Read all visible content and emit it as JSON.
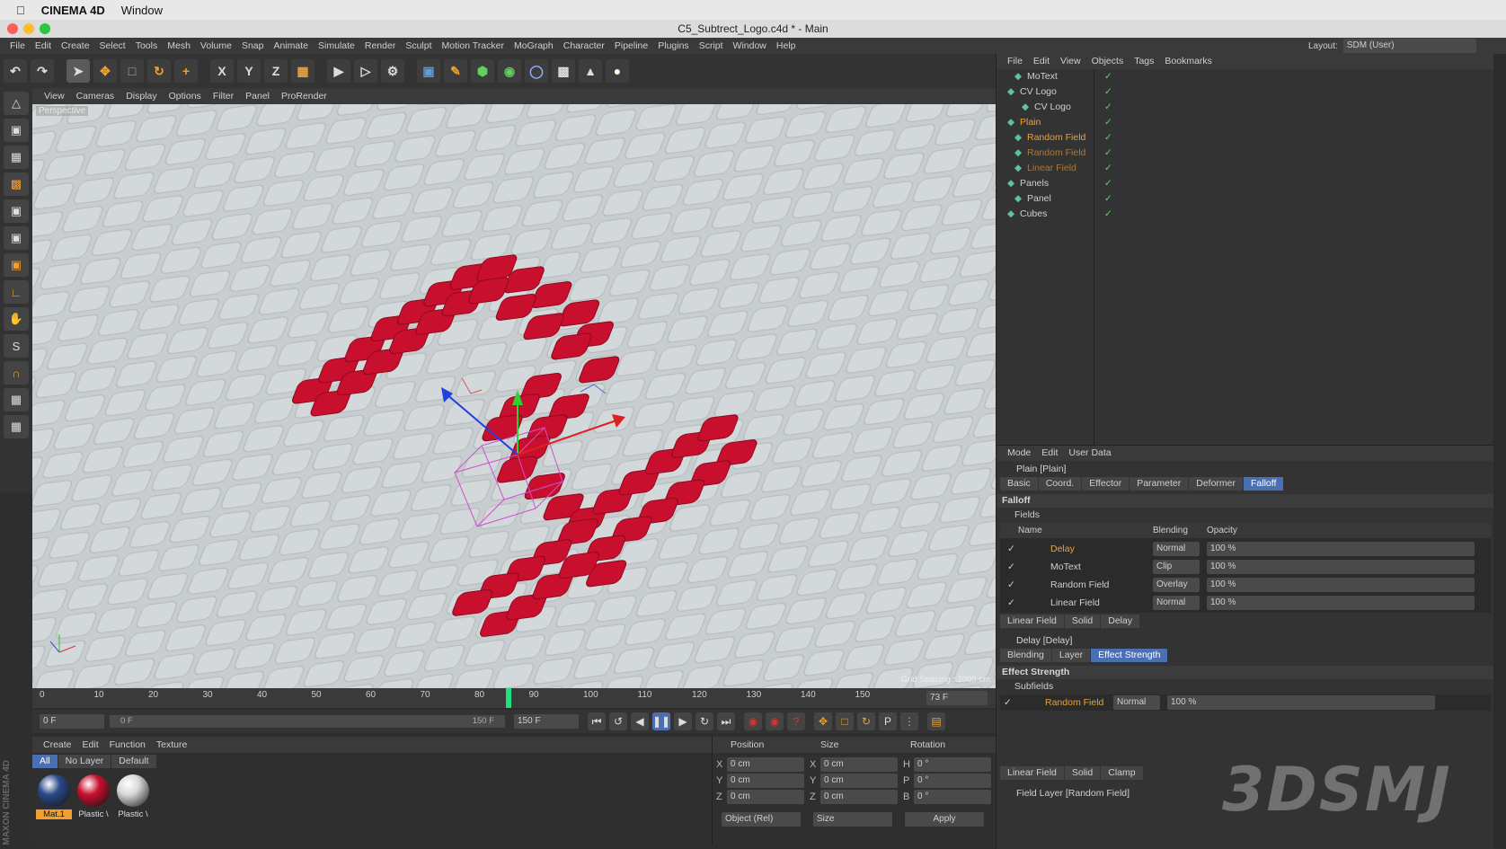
{
  "os_menu": {
    "app": "CINEMA 4D",
    "window": "Window"
  },
  "window_title": "C5_Subtrect_Logo.c4d * - Main",
  "menus": [
    "File",
    "Edit",
    "Create",
    "Select",
    "Tools",
    "Mesh",
    "Volume",
    "Snap",
    "Animate",
    "Simulate",
    "Render",
    "Sculpt",
    "Motion Tracker",
    "MoGraph",
    "Character",
    "Pipeline",
    "Plugins",
    "Script",
    "Window",
    "Help"
  ],
  "layout": {
    "label": "Layout:",
    "value": "SDM (User)"
  },
  "viewport": {
    "menus": [
      "View",
      "Cameras",
      "Display",
      "Options",
      "Filter",
      "Panel",
      "ProRender"
    ],
    "label": "Perspective",
    "grid_spacing": "Grid Spacing : 1000 cm"
  },
  "timeline": {
    "ticks": [
      "0",
      "10",
      "20",
      "30",
      "40",
      "50",
      "60",
      "70",
      "80",
      "90",
      "100",
      "110",
      "120",
      "130",
      "140",
      "150"
    ],
    "current_frame": "73 F"
  },
  "transport": {
    "start": "0 F",
    "range_start": "0 F",
    "range_end": "150 F",
    "end": "150 F"
  },
  "materials": {
    "menus": [
      "Create",
      "Edit",
      "Function",
      "Texture"
    ],
    "filters": [
      "All",
      "No Layer",
      "Default"
    ],
    "items": [
      {
        "name": "Mat.1",
        "color": "#2a4a8a"
      },
      {
        "name": "Plastic \\",
        "color": "#c8102e"
      },
      {
        "name": "Plastic \\",
        "color": "#d8d8d8"
      }
    ]
  },
  "coords": {
    "headers": [
      "Position",
      "Size",
      "Rotation"
    ],
    "rows": [
      {
        "a": "X",
        "p": "0 cm",
        "b": "X",
        "s": "0 cm",
        "c": "H",
        "r": "0 °"
      },
      {
        "a": "Y",
        "p": "0 cm",
        "b": "Y",
        "s": "0 cm",
        "c": "P",
        "r": "0 °"
      },
      {
        "a": "Z",
        "p": "0 cm",
        "b": "Z",
        "s": "0 cm",
        "c": "B",
        "r": "0 °"
      }
    ],
    "mode": "Object (Rel)",
    "size_mode": "Size",
    "apply": "Apply"
  },
  "object_manager": {
    "menus": [
      "File",
      "Edit",
      "View",
      "Objects",
      "Tags",
      "Bookmarks"
    ],
    "objects": [
      {
        "name": "MoText",
        "indent": 1,
        "color": "#cfcfcf"
      },
      {
        "name": "CV Logo",
        "indent": 0,
        "color": "#cfcfcf"
      },
      {
        "name": "CV Logo",
        "indent": 2,
        "color": "#cfcfcf"
      },
      {
        "name": "Plain",
        "indent": 0,
        "color": "#f0a030"
      },
      {
        "name": "Random Field",
        "indent": 1,
        "color": "#f0a030"
      },
      {
        "name": "Random Field",
        "indent": 1,
        "color": "#b07a30"
      },
      {
        "name": "Linear Field",
        "indent": 1,
        "color": "#b07a30"
      },
      {
        "name": "Panels",
        "indent": 0,
        "color": "#cfcfcf"
      },
      {
        "name": "Panel",
        "indent": 1,
        "color": "#cfcfcf"
      },
      {
        "name": "Cubes",
        "indent": 0,
        "color": "#cfcfcf"
      }
    ]
  },
  "attributes": {
    "menus": [
      "Mode",
      "Edit",
      "User Data"
    ],
    "object_title": "Plain [Plain]",
    "tabs": [
      "Basic",
      "Coord.",
      "Effector",
      "Parameter",
      "Deformer",
      "Falloff"
    ],
    "active_tab": "Falloff",
    "section": "Falloff",
    "fields_label": "Fields",
    "columns": [
      "Name",
      "Blending",
      "Opacity"
    ],
    "layers": [
      {
        "name": "Delay",
        "blend": "Normal",
        "opacity": "100 %",
        "color": "#f0a030"
      },
      {
        "name": "MoText",
        "blend": "Clip",
        "opacity": "100 %",
        "color": "#cfcfcf"
      },
      {
        "name": "Random Field",
        "blend": "Overlay",
        "opacity": "100 %",
        "color": "#cfcfcf"
      },
      {
        "name": "Linear Field",
        "blend": "Normal",
        "opacity": "100 %",
        "color": "#cfcfcf"
      }
    ],
    "layer_buttons": [
      "Linear Field",
      "Solid",
      "Delay"
    ],
    "sub_title": "Delay [Delay]",
    "sub_tabs": [
      "Blending",
      "Layer",
      "Effect Strength"
    ],
    "active_sub_tab": "Effect Strength",
    "effect_section": "Effect Strength",
    "subfields_label": "Subfields",
    "subfield": {
      "name": "Random Field",
      "blend": "Normal",
      "opacity": "100 %"
    },
    "bottom_buttons": [
      "Linear Field",
      "Solid",
      "Clamp"
    ],
    "field_layer": "Field Layer [Random Field]"
  },
  "watermark": "3DSMJ"
}
